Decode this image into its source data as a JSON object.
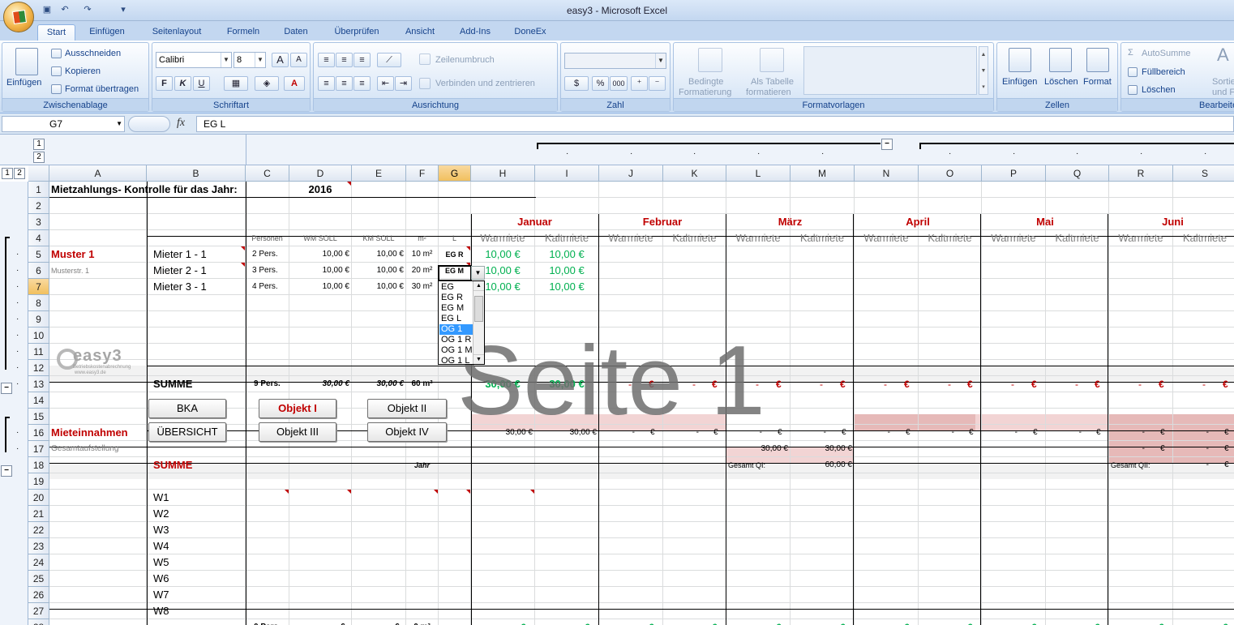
{
  "window": {
    "title": "easy3 - Microsoft Excel"
  },
  "ribbon": {
    "tabs": [
      "Start",
      "Einfügen",
      "Seitenlayout",
      "Formeln",
      "Daten",
      "Überprüfen",
      "Ansicht",
      "Add-Ins",
      "DoneEx"
    ],
    "clipboard": {
      "paste": "Einfügen",
      "cut": "Ausschneiden",
      "copy": "Kopieren",
      "format_painter": "Format übertragen",
      "label": "Zwischenablage"
    },
    "font": {
      "name": "Calibri",
      "size": "8",
      "label": "Schriftart",
      "bold": "F",
      "italic": "K",
      "underline": "U",
      "grow": "A",
      "shrink": "A",
      "font_color": "A"
    },
    "alignment": {
      "wrap": "Zeilenumbruch",
      "merge": "Verbinden und zentrieren",
      "label": "Ausrichtung"
    },
    "number": {
      "label": "Zahl",
      "percent": "%",
      "thousands": "000"
    },
    "styles": {
      "conditional": "Bedingte",
      "conditional2": "Formatierung",
      "as_table": "Als Tabelle",
      "as_table2": "formatieren",
      "label": "Formatvorlagen"
    },
    "cells": {
      "insert": "Einfügen",
      "delete": "Löschen",
      "format": "Format",
      "label": "Zellen"
    },
    "editing": {
      "autosum": "AutoSumme",
      "fill": "Füllbereich",
      "clear": "Löschen",
      "sort1": "Sortie",
      "sort2": "und Fil",
      "label": "Bearbeite"
    }
  },
  "formula": {
    "cell": "G7",
    "fx": "fx",
    "value": "EG L"
  },
  "outline": {
    "levels_top": [
      "1",
      "2"
    ],
    "levels_left": [
      "1",
      "2"
    ],
    "collapse": "−"
  },
  "columns": [
    "A",
    "B",
    "C",
    "D",
    "E",
    "F",
    "G",
    "H",
    "I",
    "J",
    "K",
    "L",
    "M",
    "N",
    "O",
    "P",
    "Q",
    "R",
    "S"
  ],
  "rows": [
    "1",
    "2",
    "3",
    "4",
    "5",
    "6",
    "7",
    "8",
    "9",
    "10",
    "11",
    "12",
    "13",
    "14",
    "15",
    "16",
    "17",
    "18",
    "19",
    "20",
    "21",
    "22",
    "23",
    "24",
    "25",
    "26",
    "27",
    "28"
  ],
  "sheet": {
    "r1_title": "Mietzahlungs- Kontrolle für das Jahr:",
    "r1_year": "2016",
    "months": [
      "Januar",
      "Februar",
      "März",
      "April",
      "Mai",
      "Juni"
    ],
    "subheads": [
      "Warmiete",
      "Kaltmiete"
    ],
    "col_heads": {
      "personen": "Personen",
      "wm": "WM SOLL",
      "km": "KM SOLL",
      "m2": "m²",
      "l": "L"
    },
    "muster": "Muster 1",
    "musterstr": "Musterstr. 1",
    "tenants": [
      {
        "name": "Mieter 1 - 1",
        "pers": "2 Pers.",
        "wm": "10,00 €",
        "km": "10,00 €",
        "m2": "10 m²",
        "l": "EG R",
        "warm": "10,00 €",
        "kalt": "10,00 €"
      },
      {
        "name": "Mieter 2 - 1",
        "pers": "3 Pers.",
        "wm": "10,00 €",
        "km": "10,00 €",
        "m2": "20 m²",
        "l": "EG M",
        "warm": "10,00 €",
        "kalt": "10,00 €"
      },
      {
        "name": "Mieter 3 - 1",
        "pers": "4 Pers.",
        "wm": "10,00 €",
        "km": "10,00 €",
        "m2": "30 m²",
        "l": "EG L",
        "warm": "10,00 €",
        "kalt": "10,00 €"
      }
    ],
    "summe": "SUMME",
    "sum13": {
      "pers": "9 Pers.",
      "wm": "30,00 €",
      "km": "30,00 €",
      "m2": "60 m²",
      "warm": "30,00 €",
      "kalt": "30,00 €",
      "dash": "-",
      "euro": "€"
    },
    "buttons": {
      "bka": "BKA",
      "uebersicht": "ÜBERSICHT",
      "obj1": "Objekt I",
      "obj2": "Objekt II",
      "obj3": "Objekt III",
      "obj4": "Objekt IV"
    },
    "mieteinnahmen": "Mieteinnahmen",
    "gesamt": "Gesamtaufstellung",
    "r16": {
      "h": "30,00 €",
      "i": "30,00 €"
    },
    "r17": {
      "l": "30,00 €",
      "m": "30,00 €"
    },
    "r18": {
      "summe": "SUMME",
      "jahr": "Jahr",
      "gq1": "Gesamt QI:",
      "gq1v": "60,00 €",
      "gq2": "Gesamt QII:"
    },
    "w": [
      "W1",
      "W2",
      "W3",
      "W4",
      "W5",
      "W6",
      "W7",
      "W8"
    ],
    "r28": {
      "pers": "0 Pers.",
      "m2": "0 m²"
    },
    "watermark": "Seite 1",
    "logo": "easy3",
    "logo_sub": "Betriebskostenabrechnung",
    "logo_url": "www.easy3.de"
  },
  "dropdown": {
    "items": [
      "EG",
      "EG R",
      "EG M",
      "EG L",
      "OG 1",
      "OG 1 R",
      "OG 1 M",
      "OG 1 L"
    ],
    "selected": 4
  }
}
